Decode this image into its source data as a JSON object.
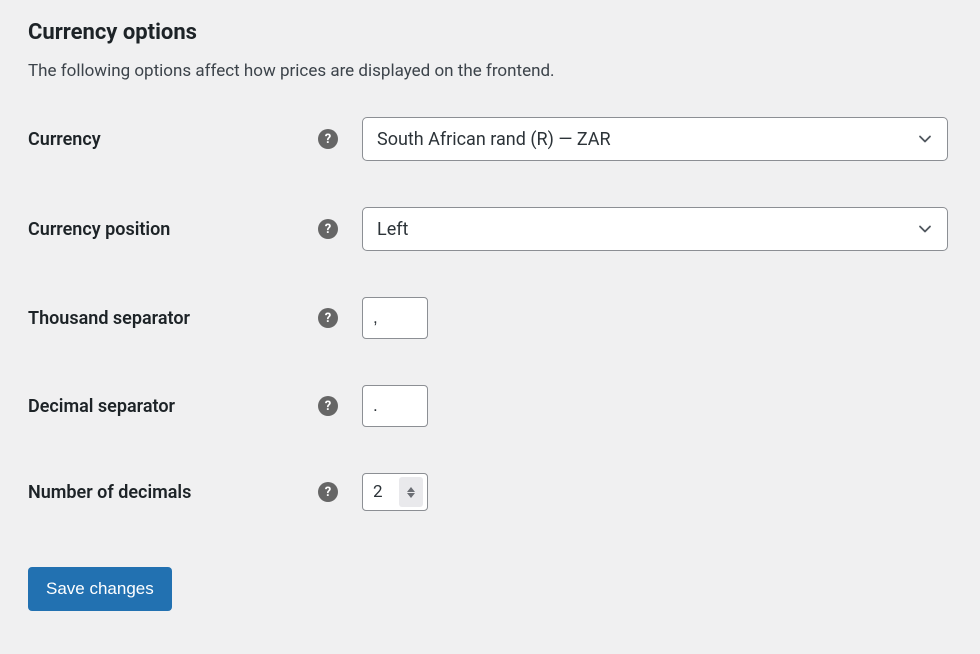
{
  "section": {
    "title": "Currency options",
    "description": "The following options affect how prices are displayed on the frontend."
  },
  "fields": {
    "currency": {
      "label": "Currency",
      "value": "South African rand (R) — ZAR"
    },
    "currency_position": {
      "label": "Currency position",
      "value": "Left"
    },
    "thousand_separator": {
      "label": "Thousand separator",
      "value": ","
    },
    "decimal_separator": {
      "label": "Decimal separator",
      "value": "."
    },
    "number_of_decimals": {
      "label": "Number of decimals",
      "value": "2"
    }
  },
  "help_icon_glyph": "?",
  "button": {
    "save": "Save changes"
  }
}
